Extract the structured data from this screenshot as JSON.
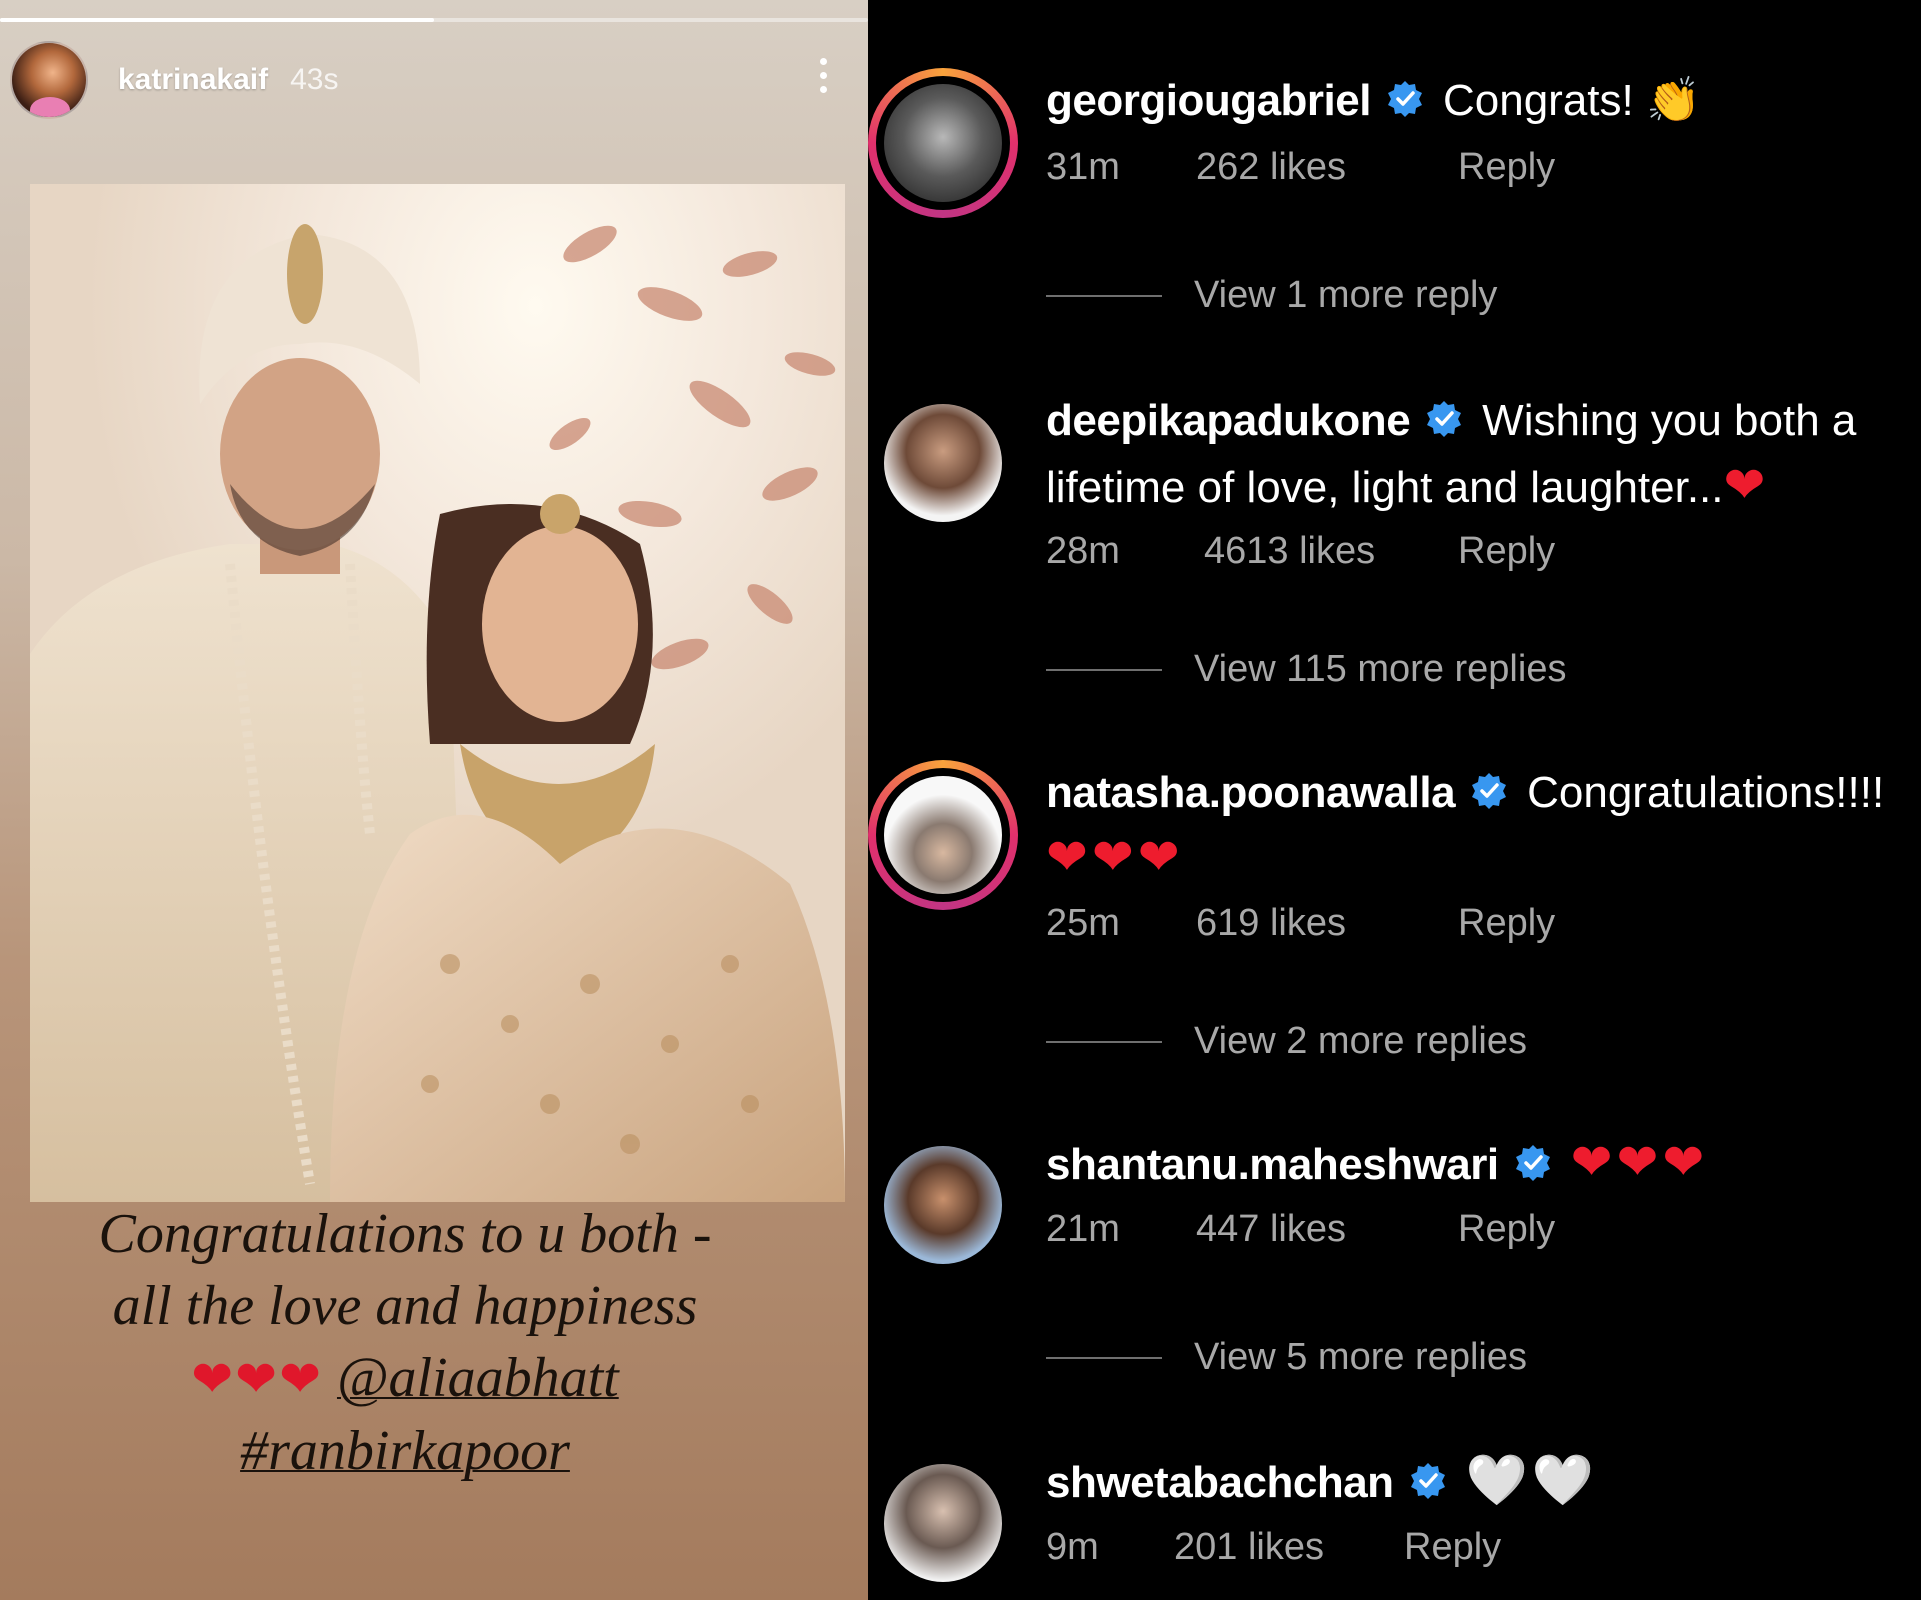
{
  "story": {
    "username": "katrinakaif",
    "time": "43s",
    "progress": 0.5,
    "caption": {
      "line1": "Congratulations to u both -",
      "line2": "all the love and happiness",
      "hearts": "❤❤❤",
      "mention": "@aliaabhatt",
      "hashtag": "#ranbirkapoor"
    }
  },
  "comments": [
    {
      "username": "georgiougabriel",
      "text": "Congrats!",
      "emoji": "👏",
      "time": "31m",
      "likes": "262 likes",
      "reply": "Reply",
      "view_more": "View 1 more reply",
      "ring": true
    },
    {
      "username": "deepikapadukone",
      "text": "Wishing you both a lifetime of love, light and laughter...",
      "emoji": "❤",
      "time": "28m",
      "likes": "4613 likes",
      "reply": "Reply",
      "view_more": "View 115 more replies",
      "ring": false
    },
    {
      "username": "natasha.poonawalla",
      "text": "Congratulations!!!!",
      "emoji": "❤❤❤",
      "time": "25m",
      "likes": "619 likes",
      "reply": "Reply",
      "view_more": "View 2 more replies",
      "ring": true
    },
    {
      "username": "shantanu.maheshwari",
      "text": "",
      "emoji": "❤❤❤",
      "time": "21m",
      "likes": "447 likes",
      "reply": "Reply",
      "view_more": "View 5 more replies",
      "ring": false
    },
    {
      "username": "shwetabachchan",
      "text": "",
      "emoji": "🤍🤍",
      "time": "9m",
      "likes": "201 likes",
      "reply": "Reply",
      "ring": false
    }
  ],
  "icons": {
    "verified": "verified-badge-icon",
    "more": "more-vertical-icon",
    "verified_color": "#3897f0"
  }
}
